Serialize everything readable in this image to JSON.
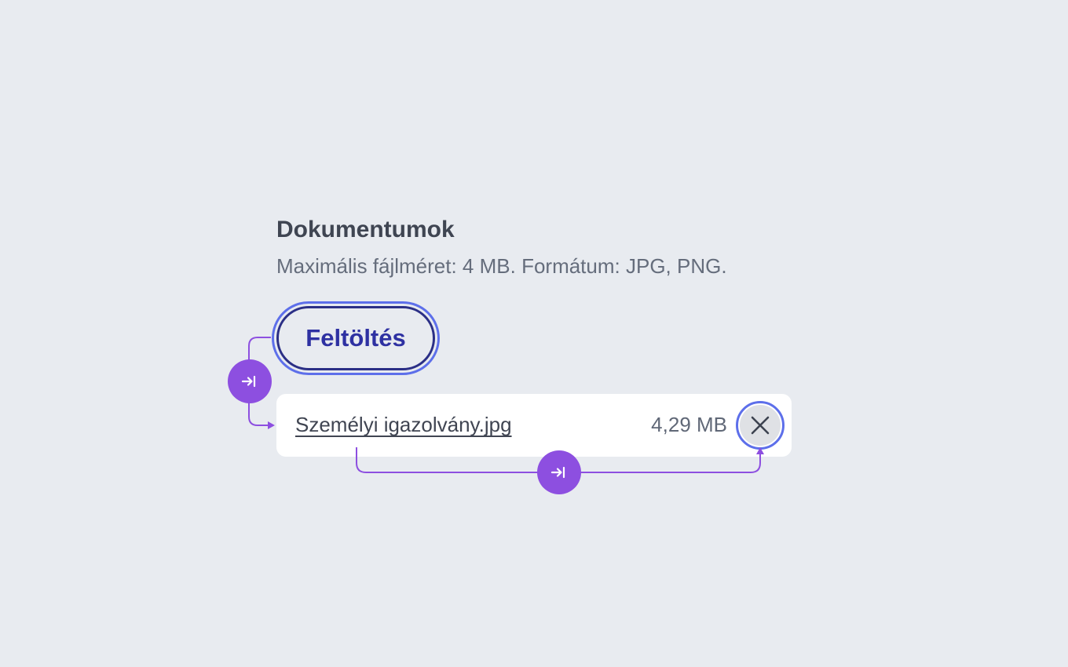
{
  "section": {
    "title": "Dokumentumok",
    "hint": "Maximális fájlméret: 4 MB. Formátum: JPG, PNG."
  },
  "upload_button": {
    "label": "Feltöltés"
  },
  "files": [
    {
      "name": "Személyi igazolvány.jpg",
      "size": "4,29 MB"
    }
  ],
  "icons": {
    "remove": "close-icon",
    "focus_order": "tab-key-icon"
  },
  "colors": {
    "background": "#e8ebf0",
    "focus_ring": "#5d6fea",
    "tab_order_marker": "#8d4fe0",
    "button_text": "#2e31a2"
  }
}
